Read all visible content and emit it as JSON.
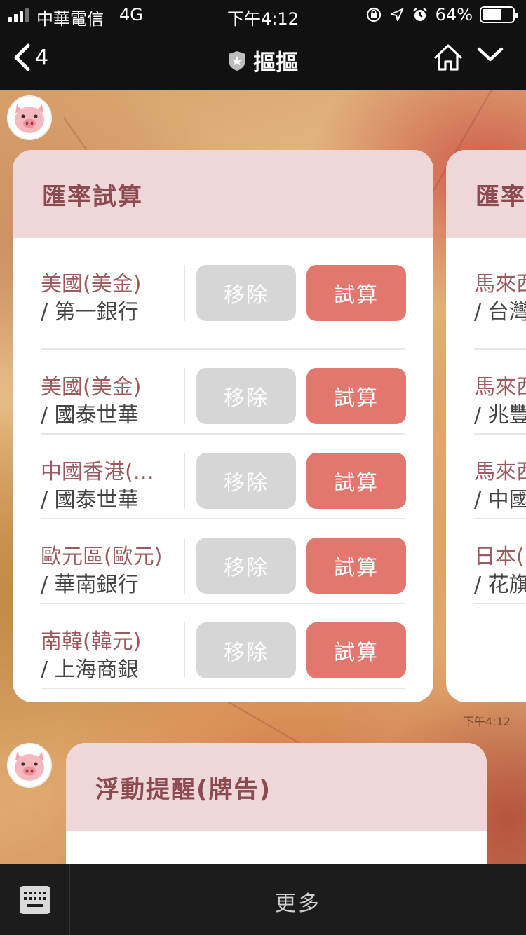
{
  "status": {
    "carrier": "中華電信",
    "network": "4G",
    "time": "下午4:12",
    "battery": "64%",
    "battery_level": 0.64
  },
  "nav": {
    "back_count": "4",
    "title": "摳摳"
  },
  "card_main": {
    "title": "匯率試算",
    "rows": [
      {
        "currency": "美國(美金)",
        "bank": "/ 第一銀行",
        "remove": "移除",
        "calc": "試算"
      },
      {
        "currency": "美國(美金)",
        "bank": "/ 國泰世華",
        "remove": "移除",
        "calc": "試算"
      },
      {
        "currency": "中國香港(…",
        "bank": "/ 國泰世華",
        "remove": "移除",
        "calc": "試算"
      },
      {
        "currency": "歐元區(歐元)",
        "bank": "/ 華南銀行",
        "remove": "移除",
        "calc": "試算"
      },
      {
        "currency": "南韓(韓元)",
        "bank": "/ 上海商銀",
        "remove": "移除",
        "calc": "試算"
      }
    ]
  },
  "card_second": {
    "title": "匯率",
    "rows": [
      {
        "currency": "馬來西",
        "bank": "/ 台灣"
      },
      {
        "currency": "馬來西",
        "bank": "/ 兆豐"
      },
      {
        "currency": "馬來西",
        "bank": "/ 中國"
      },
      {
        "currency": "日本(",
        "bank": "/ 花旗"
      }
    ]
  },
  "timestamp": "下午4:12",
  "card_alert": {
    "title": "浮動提醒(牌告)"
  },
  "bottom": {
    "more_label": "更多"
  },
  "colors": {
    "accent": "#e2776f",
    "header_bg": "#efd6d8",
    "header_text": "#8b4b50",
    "remove_bg": "#d6d6d6"
  }
}
